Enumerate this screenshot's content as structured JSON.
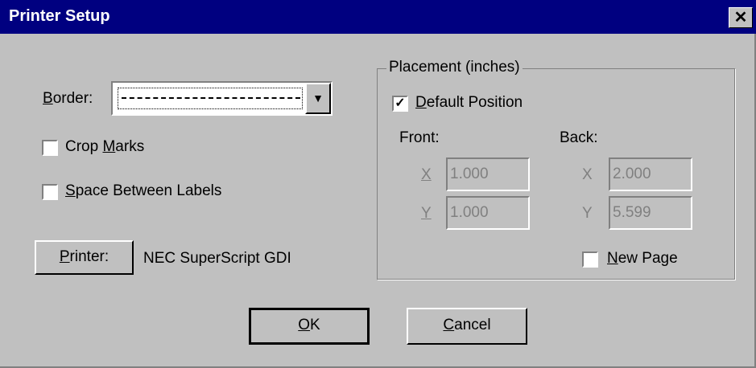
{
  "window": {
    "title": "Printer Setup",
    "close_glyph": "✕"
  },
  "border": {
    "label": "Border:",
    "mnemonic": "B",
    "rest": "order:",
    "selected": "— — — — dashed line"
  },
  "crop_marks": {
    "mnemonic_prefix": "Crop ",
    "mnemonic": "M",
    "rest": "arks",
    "checked": false
  },
  "space_between": {
    "mnemonic": "S",
    "rest": "pace Between Labels",
    "checked": false
  },
  "printer": {
    "button_mnemonic": "P",
    "button_rest": "rinter:",
    "name": "NEC SuperScript GDI"
  },
  "placement": {
    "legend": "Placement (inches)",
    "default_position": {
      "mnemonic": "D",
      "rest": "efault Position",
      "checked": true
    },
    "front_label": "Front:",
    "back_label": "Back:",
    "front_x_label": "X",
    "front_y_label": "Y",
    "back_x_label": "X",
    "back_y_label": "Y",
    "front_x": "1.000",
    "front_y": "1.000",
    "back_x": "2.000",
    "back_y": "5.599",
    "new_page": {
      "mnemonic": "N",
      "rest": "ew Page",
      "checked": false
    }
  },
  "buttons": {
    "ok_mnemonic": "O",
    "ok_rest": "K",
    "cancel_mnemonic": "C",
    "cancel_rest": "ancel"
  },
  "icons": {
    "dropdown": "dropdown-arrow-icon",
    "check": "checkmark-icon",
    "close": "close-icon"
  }
}
